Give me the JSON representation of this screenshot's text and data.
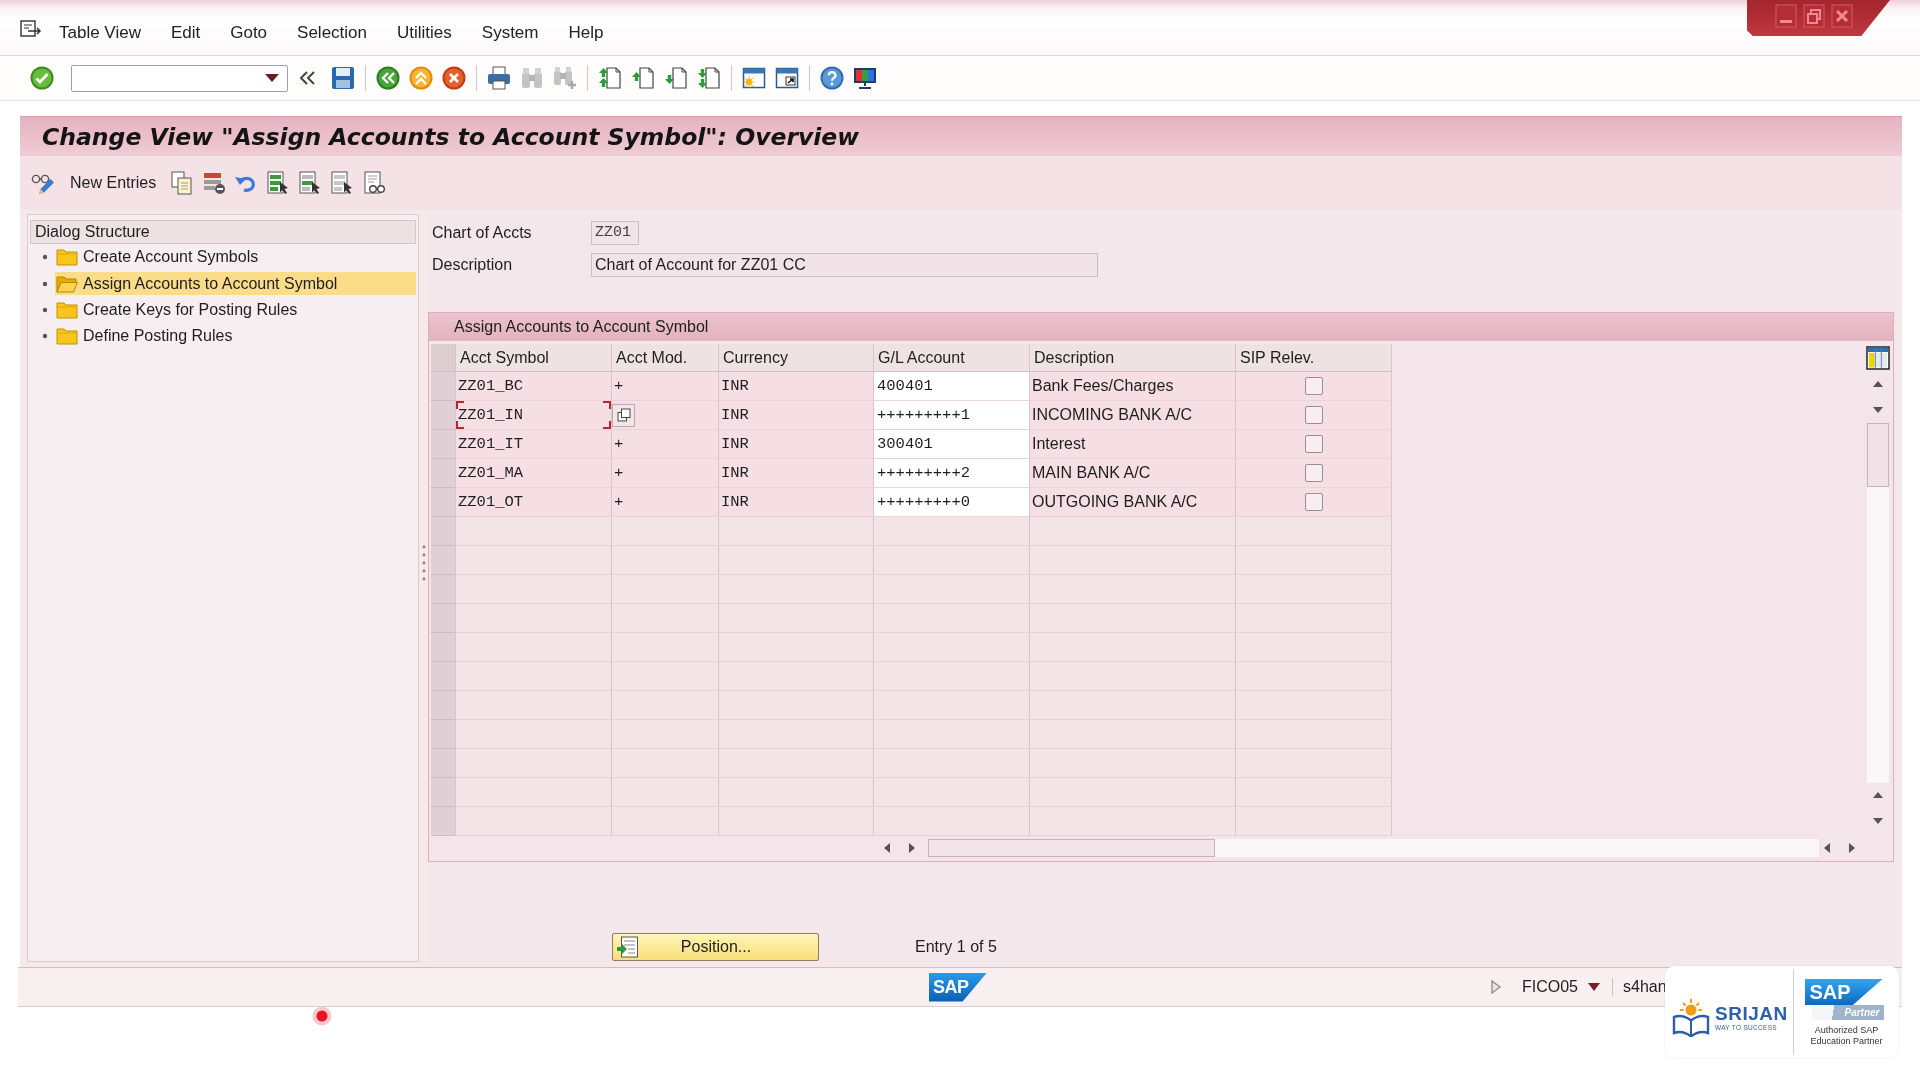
{
  "menu_bar": {
    "items": [
      "Table View",
      "Edit",
      "Goto",
      "Selection",
      "Utilities",
      "System",
      "Help"
    ]
  },
  "title": "Change View \"Assign Accounts to Account Symbol\": Overview",
  "app_toolbar": {
    "new_entries": "New Entries"
  },
  "dialog_structure": {
    "title": "Dialog Structure",
    "items": [
      {
        "label": "Create Account Symbols",
        "selected": false
      },
      {
        "label": "Assign Accounts to Account Symbol",
        "selected": true
      },
      {
        "label": "Create Keys for Posting Rules",
        "selected": false
      },
      {
        "label": "Define Posting Rules",
        "selected": false
      }
    ]
  },
  "header_fields": [
    {
      "kind": "code",
      "label": "Chart of Accts",
      "value": "ZZ01"
    },
    {
      "kind": "text",
      "label": "Description",
      "value": "Chart of Account for ZZ01 CC"
    }
  ],
  "table": {
    "title": "Assign Accounts to Account Symbol",
    "columns": [
      "Acct Symbol",
      "Acct Mod.",
      "Currency",
      "G/L Account",
      "Description",
      "SIP Relev."
    ],
    "rows": [
      {
        "acct_symbol": "ZZ01_BC",
        "acct_mod": "+",
        "currency": "INR",
        "gl_account": "400401",
        "description": "Bank Fees/Charges",
        "sip_relevant": false,
        "focused": false,
        "value_help": false
      },
      {
        "acct_symbol": "ZZ01_IN",
        "currency": "INR",
        "gl_account": "+++++++++1",
        "description": "INCOMING BANK A/C",
        "sip_relevant": false,
        "focused": true,
        "value_help": true
      },
      {
        "acct_symbol": "ZZ01_IT",
        "acct_mod": "+",
        "currency": "INR",
        "gl_account": "300401",
        "description": "Interest",
        "sip_relevant": false,
        "focused": false,
        "value_help": false
      },
      {
        "acct_symbol": "ZZ01_MA",
        "acct_mod": "+",
        "currency": "INR",
        "gl_account": "+++++++++2",
        "description": "MAIN BANK A/C",
        "sip_relevant": false,
        "focused": false,
        "value_help": false
      },
      {
        "acct_symbol": "ZZ01_OT",
        "acct_mod": "+",
        "currency": "INR",
        "gl_account": "+++++++++0",
        "description": "OUTGOING BANK A/C",
        "sip_relevant": false,
        "focused": false,
        "value_help": false
      }
    ]
  },
  "position_button": "Position...",
  "entry_info": "Entry 1 of 5",
  "status_bar": {
    "logo": "SAP",
    "fields": [
      "FICO05",
      "s4han"
    ]
  },
  "branding": {
    "name": "SRIJAN",
    "tagline": "WAY TO SUCCESS",
    "partner_logo": "SAP",
    "partner_badge": "Partner",
    "partner_caption": "Authorized SAP Education Partner"
  }
}
